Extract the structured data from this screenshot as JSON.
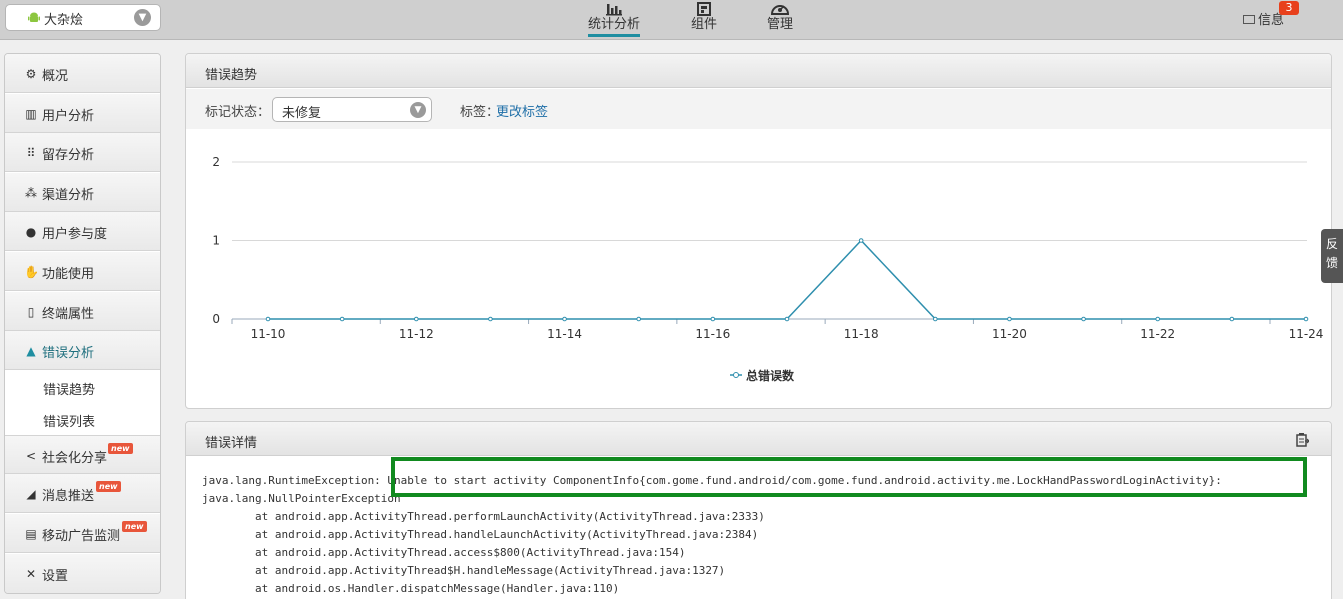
{
  "app_selector": {
    "name": "大杂烩",
    "icon": "android-icon"
  },
  "top_nav": [
    {
      "label": "统计分析",
      "icon": "bar-chart-icon",
      "active": true
    },
    {
      "label": "组件",
      "icon": "component-icon",
      "active": false
    },
    {
      "label": "管理",
      "icon": "manage-icon",
      "active": false
    }
  ],
  "messages": {
    "label": "信息",
    "count": "3"
  },
  "sidebar": {
    "items": [
      {
        "label": "概况",
        "icon": "gears-icon"
      },
      {
        "label": "用户分析",
        "icon": "bar-chart-icon"
      },
      {
        "label": "留存分析",
        "icon": "grid-icon"
      },
      {
        "label": "渠道分析",
        "icon": "sitemap-icon"
      },
      {
        "label": "用户参与度",
        "icon": "user-icon"
      },
      {
        "label": "功能使用",
        "icon": "hand-icon"
      },
      {
        "label": "终端属性",
        "icon": "phone-icon"
      },
      {
        "label": "错误分析",
        "icon": "warning-icon",
        "active": true
      }
    ],
    "sub_items": [
      "错误趋势",
      "错误列表"
    ],
    "items_after": [
      {
        "label": "社会化分享",
        "icon": "share-icon",
        "badge": "new"
      },
      {
        "label": "消息推送",
        "icon": "send-icon",
        "badge": "new"
      },
      {
        "label": "移动广告监测",
        "icon": "ad-monitor-icon",
        "badge": "new"
      },
      {
        "label": "设置",
        "icon": "wrench-icon"
      }
    ]
  },
  "trend_panel": {
    "title": "错误趋势",
    "status_label": "标记状态：",
    "status_value": "未修复",
    "tag_label": "标签：",
    "tag_link": "更改标签"
  },
  "chart_data": {
    "type": "line",
    "x": [
      "11-10",
      "11-11",
      "11-12",
      "11-13",
      "11-14",
      "11-15",
      "11-16",
      "11-17",
      "11-18",
      "11-19",
      "11-20",
      "11-21",
      "11-22",
      "11-23",
      "11-24"
    ],
    "x_tick_labels": [
      "11-10",
      "11-12",
      "11-14",
      "11-16",
      "11-18",
      "11-20",
      "11-22",
      "11-24"
    ],
    "series": [
      {
        "name": "总错误数",
        "values": [
          0,
          0,
          0,
          0,
          0,
          0,
          0,
          0,
          1,
          0,
          0,
          0,
          0,
          0,
          0
        ],
        "color": "#2f8fae"
      }
    ],
    "y_ticks": [
      0,
      1,
      2
    ],
    "ylim": [
      0,
      2
    ],
    "grid": true,
    "legend": "bottom-center",
    "title": "",
    "xlabel": "",
    "ylabel": ""
  },
  "detail_panel": {
    "title": "错误详情",
    "export_icon": "export-icon",
    "highlight_color": "#118a1f",
    "code_lines": [
      "java.lang.RuntimeException: Unable to start activity ComponentInfo{com.gome.fund.android/com.gome.fund.android.activity.me.LockHandPasswordLoginActivity}:",
      "java.lang.NullPointerException",
      "        at android.app.ActivityThread.performLaunchActivity(ActivityThread.java:2333)",
      "        at android.app.ActivityThread.handleLaunchActivity(ActivityThread.java:2384)",
      "        at android.app.ActivityThread.access$800(ActivityThread.java:154)",
      "        at android.app.ActivityThread$H.handleMessage(ActivityThread.java:1327)",
      "        at android.os.Handler.dispatchMessage(Handler.java:110)"
    ]
  },
  "feedback_tab": "反馈"
}
